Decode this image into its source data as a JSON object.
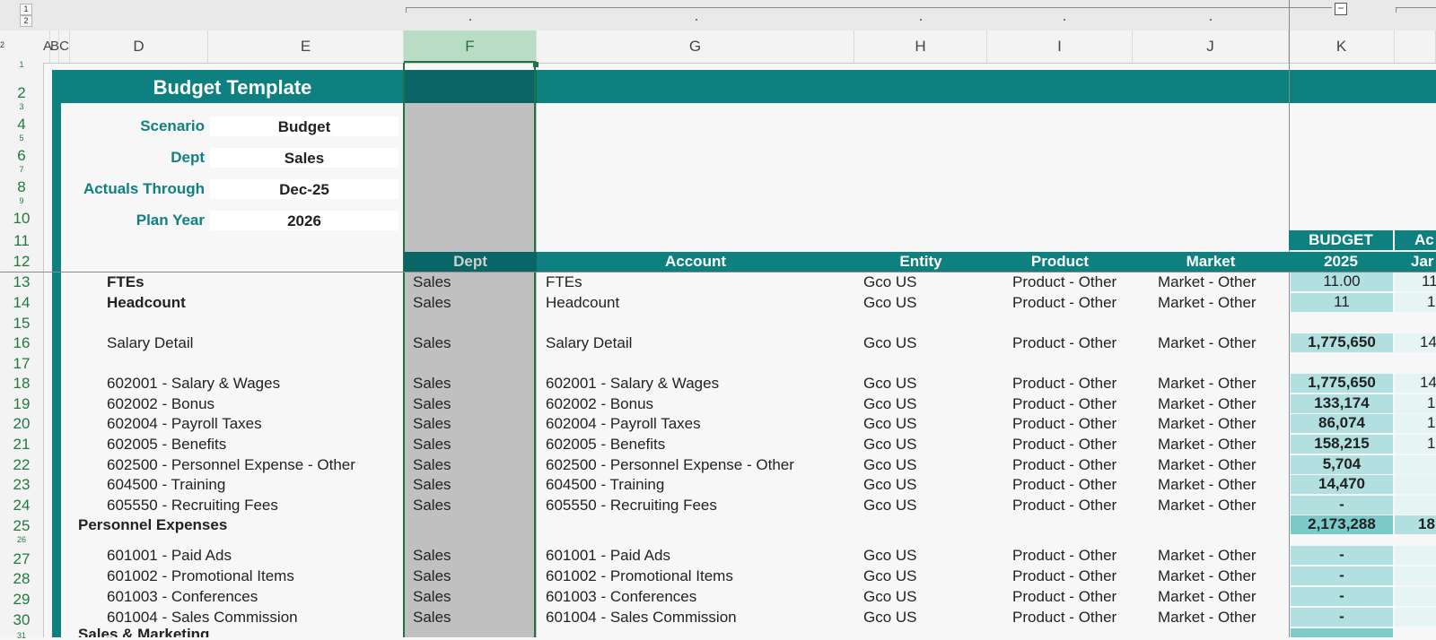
{
  "outline": {
    "levels": [
      "1",
      "2"
    ],
    "row_level": "2"
  },
  "columns": [
    "A",
    "B",
    "C",
    "D",
    "E",
    "F",
    "G",
    "H",
    "I",
    "J",
    "K"
  ],
  "row_numbers": [
    "1",
    "2",
    "3",
    "4",
    "5",
    "6",
    "7",
    "8",
    "9",
    "10",
    "11",
    "12",
    "13",
    "14",
    "15",
    "16",
    "17",
    "18",
    "19",
    "20",
    "21",
    "22",
    "23",
    "24",
    "25",
    "26",
    "27",
    "28",
    "29",
    "30",
    "31"
  ],
  "title": "Budget Template",
  "params": [
    {
      "label": "Scenario",
      "value": "Budget"
    },
    {
      "label": "Dept",
      "value": "Sales"
    },
    {
      "label": "Actuals Through",
      "value": "Dec-25"
    },
    {
      "label": "Plan Year",
      "value": "2026"
    }
  ],
  "table_headers": {
    "dept": "Dept",
    "account": "Account",
    "entity": "Entity",
    "product": "Product",
    "market": "Market",
    "budget_top": "BUDGET",
    "budget_year": "2025",
    "actual_top": "Ac",
    "actual_month": "Jar"
  },
  "rows": [
    {
      "label": "FTEs",
      "dept": "Sales",
      "account": "FTEs",
      "entity": "Gco US",
      "product": "Product - Other",
      "market": "Market - Other",
      "budget": "11.00",
      "next": "11"
    },
    {
      "label": "Headcount",
      "dept": "Sales",
      "account": "Headcount",
      "entity": "Gco US",
      "product": "Product - Other",
      "market": "Market - Other",
      "budget": "11",
      "next": "1"
    },
    {
      "label": "Salary Detail",
      "dept": "Sales",
      "account": "Salary Detail",
      "entity": "Gco US",
      "product": "Product - Other",
      "market": "Market - Other",
      "budget": "1,775,650",
      "next": "14"
    },
    {
      "label": "602001 - Salary & Wages",
      "dept": "Sales",
      "account": "602001 - Salary & Wages",
      "entity": "Gco US",
      "product": "Product - Other",
      "market": "Market - Other",
      "budget": "1,775,650",
      "next": "14"
    },
    {
      "label": "602002 - Bonus",
      "dept": "Sales",
      "account": "602002 - Bonus",
      "entity": "Gco US",
      "product": "Product - Other",
      "market": "Market - Other",
      "budget": "133,174",
      "next": "1"
    },
    {
      "label": "602004 - Payroll Taxes",
      "dept": "Sales",
      "account": "602004 - Payroll Taxes",
      "entity": "Gco US",
      "product": "Product - Other",
      "market": "Market - Other",
      "budget": "86,074",
      "next": "1"
    },
    {
      "label": "602005 - Benefits",
      "dept": "Sales",
      "account": "602005 - Benefits",
      "entity": "Gco US",
      "product": "Product - Other",
      "market": "Market - Other",
      "budget": "158,215",
      "next": "1"
    },
    {
      "label": "602500 - Personnel Expense - Other",
      "dept": "Sales",
      "account": "602500 - Personnel Expense - Other",
      "entity": "Gco US",
      "product": "Product - Other",
      "market": "Market - Other",
      "budget": "5,704",
      "next": ""
    },
    {
      "label": "604500 - Training",
      "dept": "Sales",
      "account": "604500 - Training",
      "entity": "Gco US",
      "product": "Product - Other",
      "market": "Market - Other",
      "budget": "14,470",
      "next": ""
    },
    {
      "label": "605550 - Recruiting Fees",
      "dept": "Sales",
      "account": "605550 - Recruiting Fees",
      "entity": "Gco US",
      "product": "Product - Other",
      "market": "Market - Other",
      "budget": "-",
      "next": ""
    },
    {
      "label": "Personnel Expenses",
      "dept": "",
      "account": "",
      "entity": "",
      "product": "",
      "market": "",
      "budget": "2,173,288",
      "next": "18"
    },
    {
      "label": "601001 - Paid Ads",
      "dept": "Sales",
      "account": "601001 - Paid Ads",
      "entity": "Gco US",
      "product": "Product - Other",
      "market": "Market - Other",
      "budget": "-",
      "next": ""
    },
    {
      "label": "601002 - Promotional Items",
      "dept": "Sales",
      "account": "601002 - Promotional Items",
      "entity": "Gco US",
      "product": "Product - Other",
      "market": "Market - Other",
      "budget": "-",
      "next": ""
    },
    {
      "label": "601003 - Conferences",
      "dept": "Sales",
      "account": "601003 - Conferences",
      "entity": "Gco US",
      "product": "Product - Other",
      "market": "Market - Other",
      "budget": "-",
      "next": ""
    },
    {
      "label": "601004 - Sales Commission",
      "dept": "Sales",
      "account": "601004 - Sales Commission",
      "entity": "Gco US",
      "product": "Product - Other",
      "market": "Market - Other",
      "budget": "-",
      "next": ""
    },
    {
      "label": "Sales & Marketing",
      "dept": "",
      "account": "",
      "entity": "",
      "product": "",
      "market": "",
      "budget": "",
      "next": ""
    }
  ]
}
